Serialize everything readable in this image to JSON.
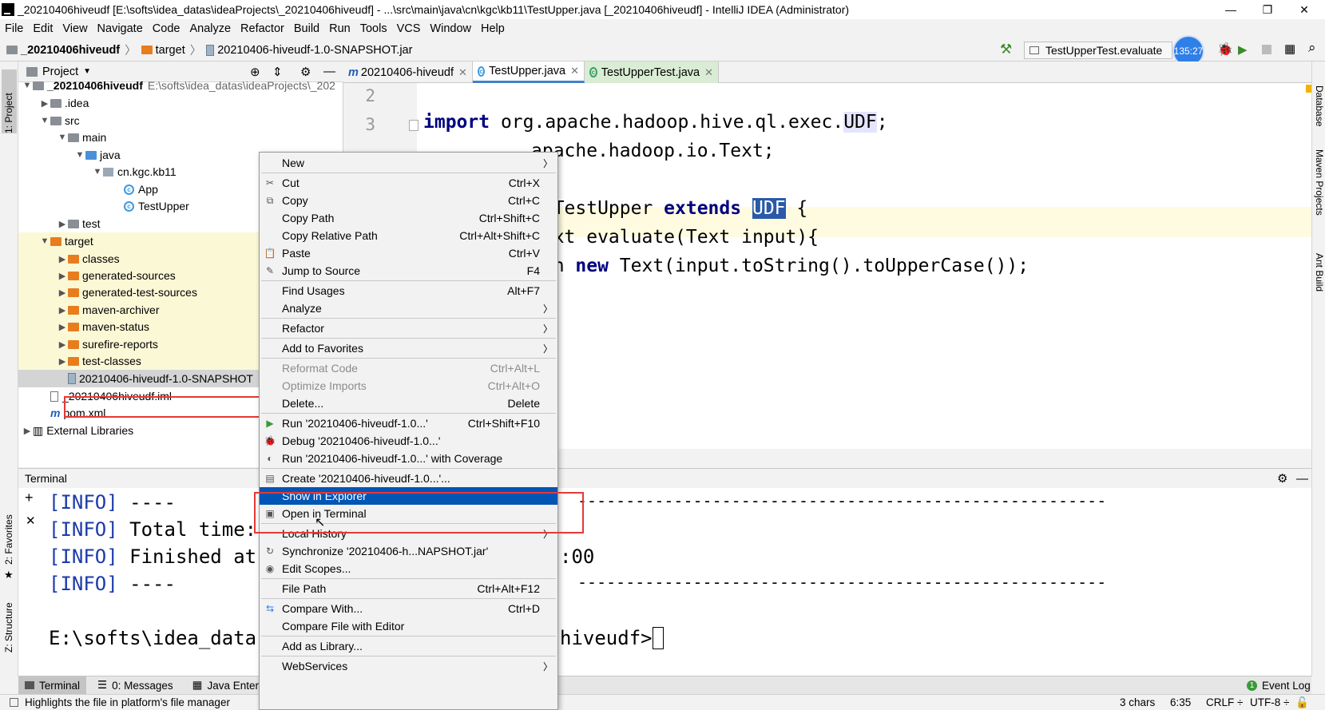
{
  "title_bar": {
    "text": "_20210406hiveudf [E:\\softs\\idea_datas\\ideaProjects\\_20210406hiveudf] - ...\\src\\main\\java\\cn\\kgc\\kb11\\TestUpper.java [_20210406hiveudf] - IntelliJ IDEA (Administrator)"
  },
  "menubar": [
    "File",
    "Edit",
    "View",
    "Navigate",
    "Code",
    "Analyze",
    "Refactor",
    "Build",
    "Run",
    "Tools",
    "VCS",
    "Window",
    "Help"
  ],
  "navbar": {
    "crumb1": "_20210406hiveudf",
    "crumb2": "target",
    "crumb3": "20210406-hiveudf-1.0-SNAPSHOT.jar",
    "run_config": "TestUpperTest.evaluate",
    "timer": "135:27"
  },
  "left_strip": {
    "project": "1: Project",
    "favorites": "2: Favorites",
    "structure": "Z: Structure"
  },
  "right_strip": {
    "database": "Database",
    "maven": "Maven Projects",
    "ant": "Ant Build"
  },
  "project": {
    "header": "Project",
    "tree": [
      {
        "label": "_20210406hiveudf",
        "extra": "E:\\softs\\idea_datas\\ideaProjects\\_202",
        "arrow": "▼",
        "icon": "folder-grey"
      },
      {
        "label": ".idea",
        "arrow": "▶",
        "icon": "folder-grey"
      },
      {
        "label": "src",
        "arrow": "▼",
        "icon": "folder-grey"
      },
      {
        "label": "main",
        "arrow": "▼",
        "icon": "folder-grey"
      },
      {
        "label": "java",
        "arrow": "▼",
        "icon": "folder-blue"
      },
      {
        "label": "cn.kgc.kb11",
        "arrow": "▼",
        "icon": "package"
      },
      {
        "label": "App",
        "arrow": "",
        "icon": "class"
      },
      {
        "label": "TestUpper",
        "arrow": "",
        "icon": "class"
      },
      {
        "label": "test",
        "arrow": "▶",
        "icon": "folder-grey"
      },
      {
        "label": "target",
        "arrow": "▼",
        "icon": "folder-orange"
      },
      {
        "label": "classes",
        "arrow": "▶",
        "icon": "folder-orange"
      },
      {
        "label": "generated-sources",
        "arrow": "▶",
        "icon": "folder-orange"
      },
      {
        "label": "generated-test-sources",
        "arrow": "▶",
        "icon": "folder-orange"
      },
      {
        "label": "maven-archiver",
        "arrow": "▶",
        "icon": "folder-orange"
      },
      {
        "label": "maven-status",
        "arrow": "▶",
        "icon": "folder-orange"
      },
      {
        "label": "surefire-reports",
        "arrow": "▶",
        "icon": "folder-orange"
      },
      {
        "label": "test-classes",
        "arrow": "▶",
        "icon": "folder-orange"
      },
      {
        "label": "20210406-hiveudf-1.0-SNAPSHOT",
        "arrow": "",
        "icon": "jar"
      },
      {
        "label": "_20210406hiveudf.iml",
        "arrow": "",
        "icon": "file"
      },
      {
        "label": "pom.xml",
        "arrow": "",
        "icon": "maven"
      },
      {
        "label": "External Libraries",
        "arrow": "▶",
        "icon": "library"
      }
    ]
  },
  "editor_tabs": [
    {
      "label": "20210406-hiveudf",
      "icon": "m"
    },
    {
      "label": "TestUpper.java",
      "icon": "c"
    },
    {
      "label": "TestUpperTest.java",
      "icon": "c"
    }
  ],
  "editor": {
    "line_numbers": [
      "2",
      "3"
    ],
    "line3_kw": "import",
    "line3_rest": " org.apache.hadoop.hive.ql.exec.",
    "line3_udf": "UDF",
    "line3_end": ";",
    "line4": "apache.hadoop.io.Text;",
    "line6_a": "s TestUpper ",
    "line6_kw": "extends",
    "line6_udf": "UDF",
    "line6_end": " {",
    "line7": "Text evaluate(Text input){",
    "line8_a": "urn ",
    "line8_kw": "new",
    "line8_rest": " Text(input.toString().toUpperCase());"
  },
  "terminal": {
    "header": "Terminal",
    "lines": [
      {
        "tag": "[INFO]",
        "text": " ----"
      },
      {
        "tag": "[INFO]",
        "text": " Total time:"
      },
      {
        "tag": "[INFO]",
        "text": " Finished at"
      },
      {
        "tag": "[INFO]",
        "text": " ----"
      }
    ],
    "dashes_right": "-------------------------------------------------------",
    "finished_right": ":00",
    "prompt": "E:\\softs\\idea_data",
    "prompt_right": "hiveudf>"
  },
  "context_menu": [
    {
      "label": "New",
      "shortcut": "",
      "submenu": true,
      "icon": ""
    },
    {
      "sep": true
    },
    {
      "label": "Cut",
      "shortcut": "Ctrl+X",
      "icon": "✂"
    },
    {
      "label": "Copy",
      "shortcut": "Ctrl+C",
      "icon": "⧉"
    },
    {
      "label": "Copy Path",
      "shortcut": "Ctrl+Shift+C",
      "icon": ""
    },
    {
      "label": "Copy Relative Path",
      "shortcut": "Ctrl+Alt+Shift+C",
      "icon": ""
    },
    {
      "label": "Paste",
      "shortcut": "Ctrl+V",
      "icon": "📋"
    },
    {
      "label": "Jump to Source",
      "shortcut": "F4",
      "icon": "✎"
    },
    {
      "sep": true
    },
    {
      "label": "Find Usages",
      "shortcut": "Alt+F7",
      "icon": ""
    },
    {
      "label": "Analyze",
      "shortcut": "",
      "submenu": true,
      "icon": ""
    },
    {
      "sep": true
    },
    {
      "label": "Refactor",
      "shortcut": "",
      "submenu": true,
      "icon": ""
    },
    {
      "sep": true
    },
    {
      "label": "Add to Favorites",
      "shortcut": "",
      "submenu": true,
      "icon": ""
    },
    {
      "sep": true
    },
    {
      "label": "Reformat Code",
      "shortcut": "Ctrl+Alt+L",
      "icon": "",
      "disabled": true
    },
    {
      "label": "Optimize Imports",
      "shortcut": "Ctrl+Alt+O",
      "icon": "",
      "disabled": true
    },
    {
      "label": "Delete...",
      "shortcut": "Delete",
      "icon": ""
    },
    {
      "sep": true
    },
    {
      "label": "Run '20210406-hiveudf-1.0...'",
      "shortcut": "Ctrl+Shift+F10",
      "icon": "▶"
    },
    {
      "label": "Debug '20210406-hiveudf-1.0...'",
      "shortcut": "",
      "icon": "🐞"
    },
    {
      "label": "Run '20210406-hiveudf-1.0...' with Coverage",
      "shortcut": "",
      "icon": "◐"
    },
    {
      "sep": true
    },
    {
      "label": "Create '20210406-hiveudf-1.0...'...",
      "shortcut": "",
      "icon": "▤"
    },
    {
      "label": "Show in Explorer",
      "shortcut": "",
      "icon": "",
      "selected": true
    },
    {
      "label": "Open in Terminal",
      "shortcut": "",
      "icon": "▣"
    },
    {
      "sep": true
    },
    {
      "label": "Local History",
      "shortcut": "",
      "submenu": true,
      "icon": ""
    },
    {
      "label": "Synchronize '20210406-h...NAPSHOT.jar'",
      "shortcut": "",
      "icon": "↻"
    },
    {
      "label": "Edit Scopes...",
      "shortcut": "",
      "icon": "◉"
    },
    {
      "sep": true
    },
    {
      "label": "File Path",
      "shortcut": "Ctrl+Alt+F12",
      "icon": ""
    },
    {
      "sep": true
    },
    {
      "label": "Compare With...",
      "shortcut": "Ctrl+D",
      "icon": "⇆"
    },
    {
      "label": "Compare File with Editor",
      "shortcut": "",
      "icon": ""
    },
    {
      "sep": true
    },
    {
      "label": "Add as Library...",
      "shortcut": "",
      "icon": ""
    },
    {
      "sep": true
    },
    {
      "label": "WebServices",
      "shortcut": "",
      "submenu": true,
      "icon": ""
    }
  ],
  "bottom_tabs": {
    "terminal": "Terminal",
    "messages": "0: Messages",
    "java": "Java Enterp",
    "event_log": "Event Log"
  },
  "status": {
    "hint": "Highlights the file in platform's file manager",
    "chars": "3 chars",
    "pos": "6:35",
    "crlf": "CRLF ÷",
    "enc": "UTF-8 ÷"
  }
}
